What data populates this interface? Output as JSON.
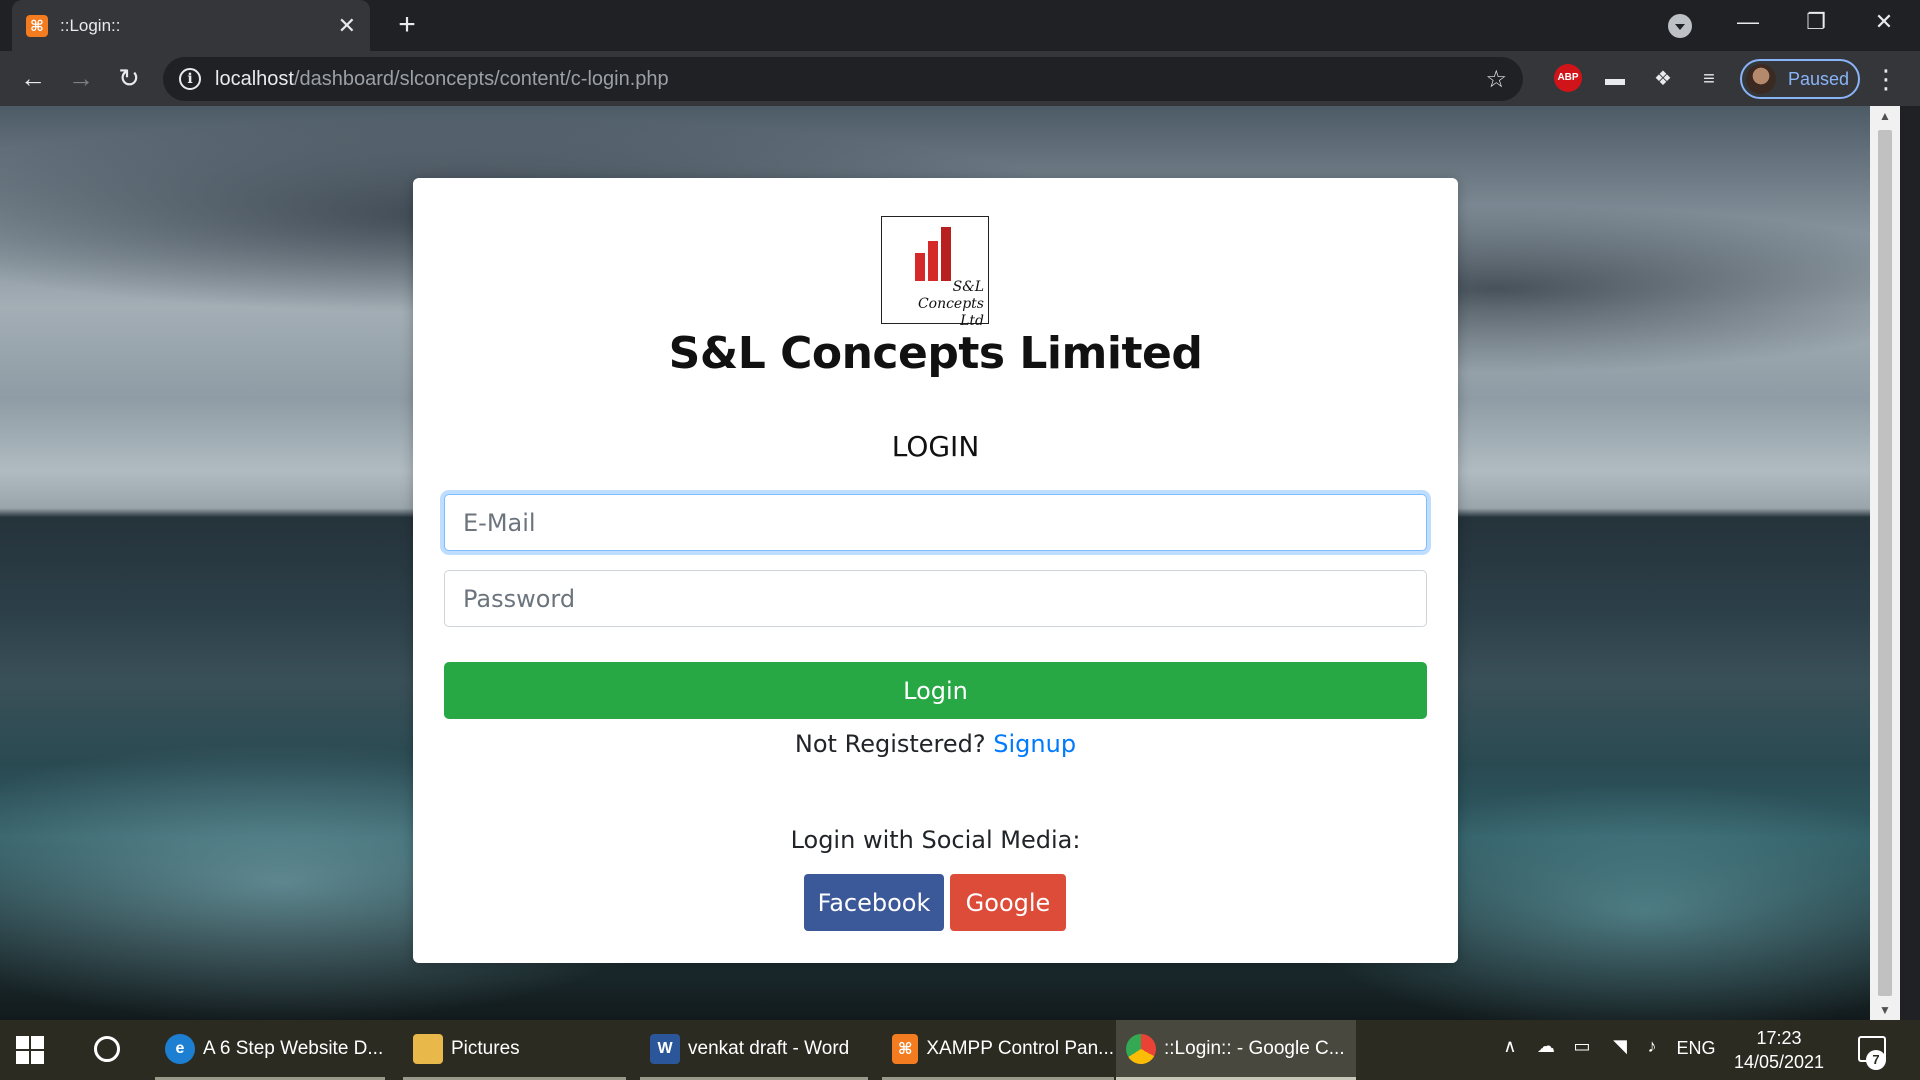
{
  "browser": {
    "tab_title": "::Login::",
    "tab_favicon": "xampp-icon",
    "url_host": "localhost",
    "url_path": "/dashboard/slconcepts/content/c-login.php",
    "profile_status": "Paused",
    "extension_abp": "ABP"
  },
  "page": {
    "logo_line1": "S&L Concepts",
    "logo_line2": "Ltd",
    "company_name": "S&L Concepts Limited",
    "login_heading": "LOGIN",
    "email_placeholder": "E-Mail",
    "password_placeholder": "Password",
    "login_button": "Login",
    "not_registered": "Not Registered?",
    "signup_link": "Signup",
    "social_label": "Login with Social Media:",
    "facebook_button": "Facebook",
    "google_button": "Google",
    "colors": {
      "login_green": "#28a745",
      "link_blue": "#007bff",
      "facebook_blue": "#3b5998",
      "google_red": "#dd4b39",
      "logo_red": "#d42a2a"
    }
  },
  "taskbar": {
    "apps": [
      {
        "label": "A 6 Step Website D...",
        "icon": "edge-icon",
        "color": "#1d7fd1"
      },
      {
        "label": "Pictures",
        "icon": "folder-icon",
        "color": "#e8b84a"
      },
      {
        "label": "venkat draft - Word",
        "icon": "word-icon",
        "color": "#2b579a"
      },
      {
        "label": "XAMPP Control Pan...",
        "icon": "xampp-icon",
        "color": "#f47c20"
      },
      {
        "label": "::Login:: - Google C...",
        "icon": "chrome-icon",
        "color": "#4285f4"
      }
    ],
    "language": "ENG",
    "time": "17:23",
    "date": "14/05/2021",
    "notification_count": "7"
  }
}
